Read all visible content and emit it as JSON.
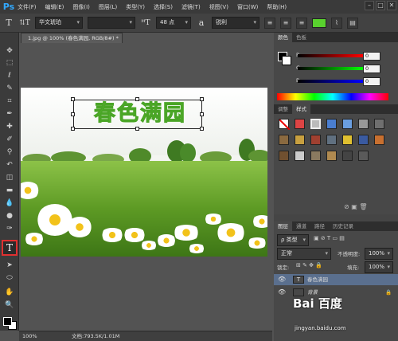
{
  "app": {
    "logo": "Ps"
  },
  "menu": [
    "文件(F)",
    "编辑(E)",
    "图像(I)",
    "图层(L)",
    "类型(Y)",
    "选择(S)",
    "滤镜(T)",
    "视图(V)",
    "窗口(W)",
    "帮助(H)"
  ],
  "window_controls": [
    "–",
    "□",
    "✕"
  ],
  "options": {
    "font_family": "华文琥珀",
    "font_style": "",
    "font_size": "48 点",
    "aa_label": "a",
    "aa_mode": "锐利",
    "text_color": "#59d12e"
  },
  "document": {
    "tab_title": "1.jpg @ 100% (春色满园, RGB/8#) *",
    "canvas_text": "春色满园"
  },
  "status": {
    "zoom": "100%",
    "doc_info": "文档:793.5K/1.01M"
  },
  "color_panel": {
    "tabs": [
      "颜色",
      "色板"
    ],
    "channels": [
      {
        "label": "R",
        "value": "0"
      },
      {
        "label": "G",
        "value": "0"
      },
      {
        "label": "B",
        "value": "0"
      }
    ]
  },
  "styles_panel": {
    "tabs": [
      "调整",
      "样式"
    ]
  },
  "layers_panel": {
    "tabs": [
      "图层",
      "通道",
      "路径",
      "历史记录"
    ],
    "filter": "ρ 类型",
    "blend_mode": "正常",
    "opacity_label": "不透明度:",
    "opacity_value": "100%",
    "lock_label": "锁定:",
    "fill_label": "填充:",
    "fill_value": "100%",
    "layers": [
      {
        "name": "春色满园",
        "type_badge": "T"
      },
      {
        "name": "背景"
      }
    ]
  },
  "watermark": {
    "brand": "Bai 百度",
    "url": "jingyan.baidu.com"
  }
}
